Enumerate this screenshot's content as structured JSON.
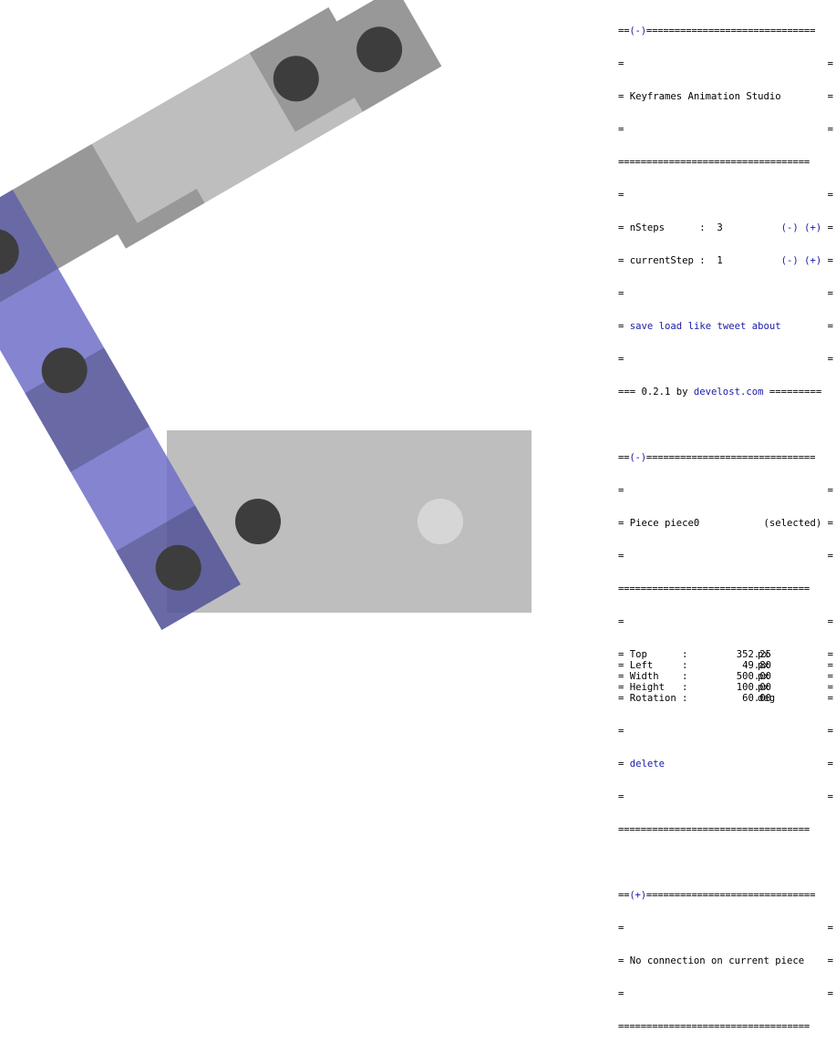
{
  "app": {
    "title": "Keyframes Animation Studio",
    "version_prefix": "=== 0.2.1 by ",
    "version_suffix": " =========",
    "site_link": "develost.com"
  },
  "steps": {
    "nsteps_label": "nSteps      :  3",
    "current_label": "currentStep :  1",
    "minus": "(-)",
    "plus": "(+)"
  },
  "menu": {
    "save": "save",
    "load": "load",
    "like": "like",
    "tweet": "tweet",
    "about": "about"
  },
  "piece_panel": {
    "toggle": "(-)",
    "name": "Piece piece0",
    "status": "(selected)",
    "props": [
      {
        "label": "Top",
        "value": "352.25",
        "unit": "px"
      },
      {
        "label": "Left",
        "value": "49.80",
        "unit": "px"
      },
      {
        "label": "Width",
        "value": "500.00",
        "unit": "px"
      },
      {
        "label": "Height",
        "value": "100.00",
        "unit": "px"
      },
      {
        "label": "Rotation",
        "value": "60.00",
        "unit": "deg"
      }
    ],
    "delete": "delete"
  },
  "top_panel_toggle": "(-)",
  "connection_panel": {
    "toggle": "(+)",
    "message": "No connection on current piece"
  },
  "colors": {
    "piece_gray": "#bebebe",
    "piece_selected": "#7a7ad0",
    "hole": "#3d3d3d",
    "link": "#1a1aa6"
  }
}
